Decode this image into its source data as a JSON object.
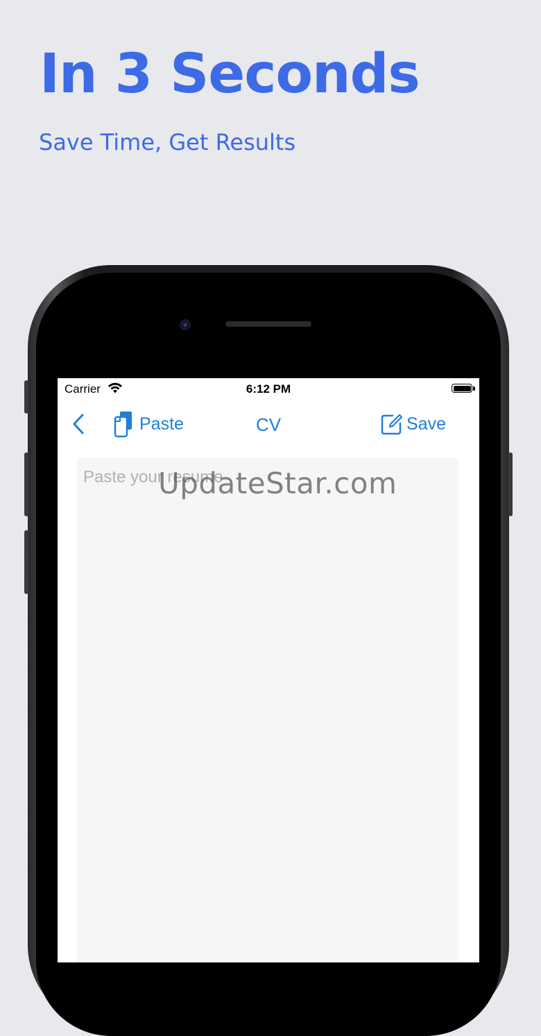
{
  "promo": {
    "headline": "In 3 Seconds",
    "subheadline": "Save Time, Get Results"
  },
  "status_bar": {
    "carrier": "Carrier",
    "time": "6:12 PM"
  },
  "nav": {
    "back_icon": "chevron-left-icon",
    "paste_label": "Paste",
    "title": "CV",
    "save_label": "Save"
  },
  "editor": {
    "placeholder": "Paste your resume"
  },
  "watermark": "UpdateStar.com",
  "colors": {
    "accent": "#3d6ae6",
    "ios_blue": "#1e7fd9",
    "background": "#e8e9ec"
  }
}
